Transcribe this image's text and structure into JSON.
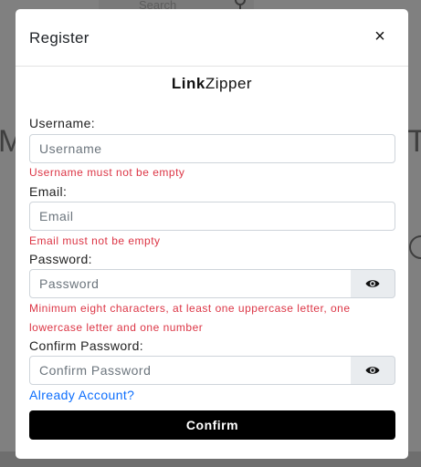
{
  "background": {
    "search_label": "Search",
    "heading_left": "Mu",
    "heading_right": "T"
  },
  "modal": {
    "title": "Register",
    "close_label": "×",
    "brand_bold": "Link",
    "brand_rest": "Zipper"
  },
  "form": {
    "username": {
      "label": "Username:",
      "placeholder": "Username",
      "value": "",
      "error": "Username must not be empty"
    },
    "email": {
      "label": "Email:",
      "placeholder": "Email",
      "value": "",
      "error": "Email must not be empty"
    },
    "password": {
      "label": "Password:",
      "placeholder": "Password",
      "value": "",
      "error": "Minimum eight characters, at least one uppercase letter, one lowercase letter and one number"
    },
    "confirm_password": {
      "label": "Confirm Password:",
      "placeholder": "Confirm Password",
      "value": ""
    },
    "account_link": "Already Account?",
    "submit_label": "Confirm"
  },
  "icons": {
    "password_toggle": "eye-icon",
    "confirm_password_toggle": "eye-icon",
    "search": "search-icon"
  },
  "colors": {
    "error": "#dc3545",
    "link": "#0d6efd",
    "button": "#000000",
    "overlay": "#808080"
  }
}
